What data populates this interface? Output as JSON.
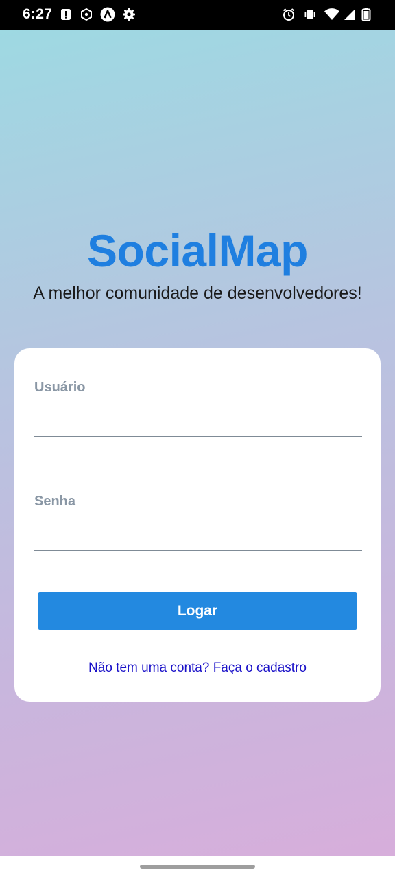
{
  "status_bar": {
    "time": "6:27",
    "left_icons": [
      "notification-alert-icon",
      "hexagon-app-icon",
      "a-app-icon",
      "settings-gear-icon"
    ],
    "right_icons": [
      "alarm-icon",
      "vibrate-icon",
      "wifi-icon",
      "signal-icon",
      "battery-icon"
    ]
  },
  "header": {
    "title": "SocialMap",
    "subtitle": "A melhor comunidade de desenvolvedores!"
  },
  "login_form": {
    "username_label": "Usuário",
    "username_value": "",
    "password_label": "Senha",
    "password_value": "",
    "login_button_label": "Logar",
    "signup_link_text": "Não tem uma conta? Faça o cadastro"
  },
  "colors": {
    "accent": "#2389e0",
    "title": "#1f7fe0",
    "link": "#1a11c8",
    "label": "#8a97a5",
    "gradient_top": "#9ed9e2",
    "gradient_bottom": "#d7aedb"
  }
}
